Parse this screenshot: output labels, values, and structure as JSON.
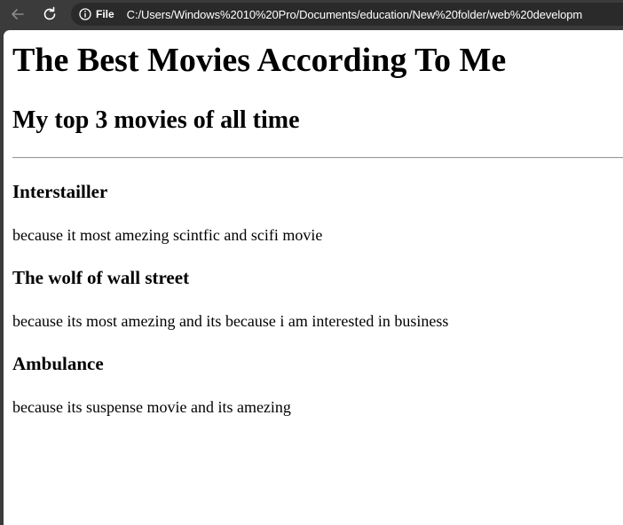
{
  "browser": {
    "address_bar": {
      "scheme_label": "File",
      "url": "C:/Users/Windows%2010%20Pro/Documents/education/New%20folder/web%20developm"
    }
  },
  "page": {
    "heading": "The Best Movies According To Me",
    "subheading": "My top 3 movies of all time",
    "movies": [
      {
        "title": "Interstailler",
        "description": "because it most amezing scintfic and scifi movie"
      },
      {
        "title": "The wolf of wall street",
        "description": "because its most amezing and its because i am interested in business"
      },
      {
        "title": "Ambulance",
        "description": "because its suspense movie and its amezing"
      }
    ]
  }
}
